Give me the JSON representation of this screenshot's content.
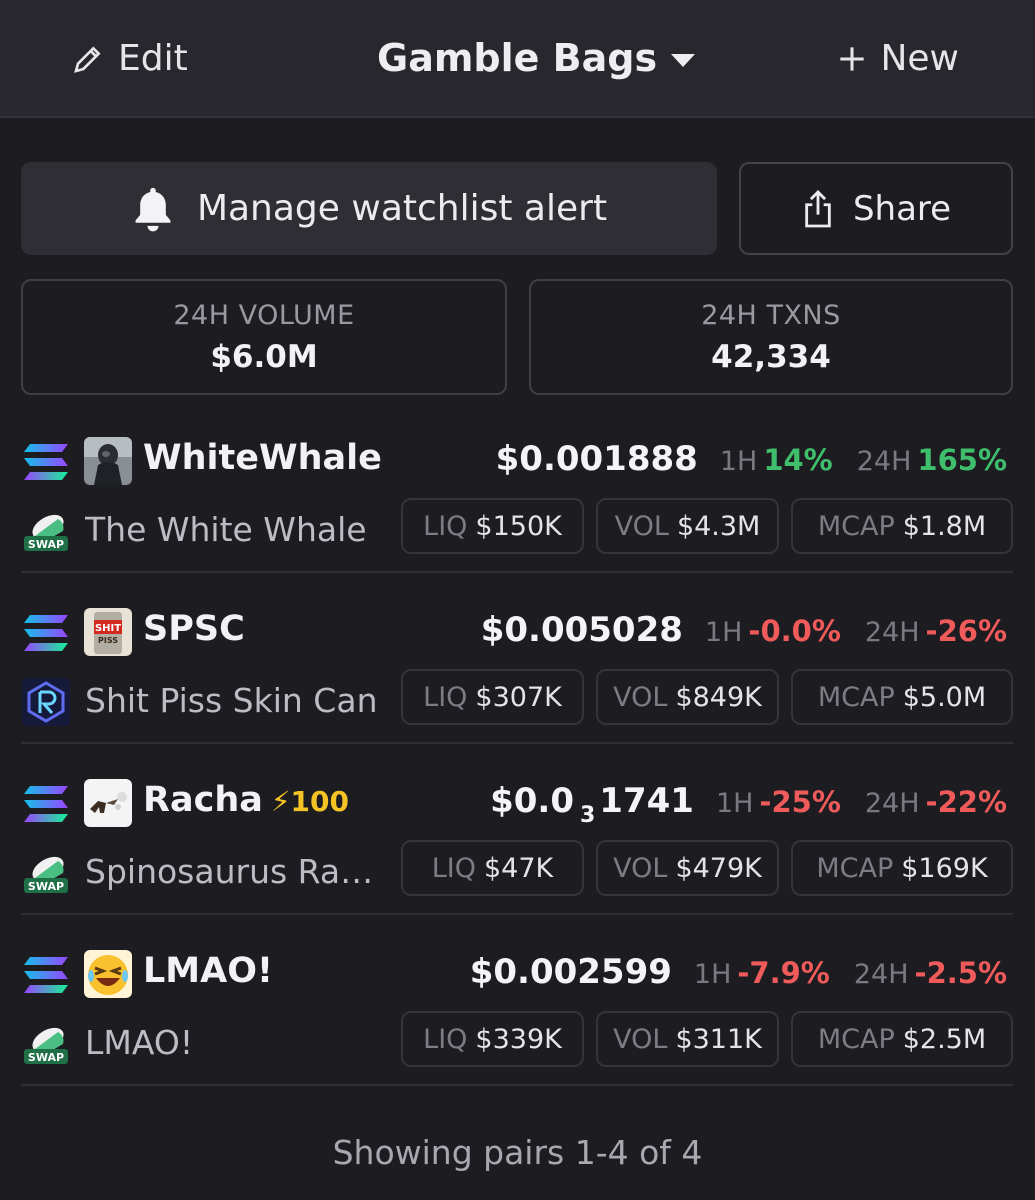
{
  "header": {
    "edit_label": "Edit",
    "title": "Gamble Bags",
    "new_label": "New"
  },
  "actions": {
    "alert_label": "Manage watchlist alert",
    "share_label": "Share"
  },
  "stats": {
    "volume_label": "24H VOLUME",
    "volume_value": "$6.0M",
    "txns_label": "24H TXNS",
    "txns_value": "42,334"
  },
  "labels": {
    "h1": "1H",
    "h24": "24H",
    "liq": "LIQ",
    "vol": "VOL",
    "mcap": "MCAP"
  },
  "pairs": [
    {
      "symbol": "WhiteWhale",
      "name": "The White Whale",
      "dex_icon": "swap-pill-icon",
      "price": "$0.001888",
      "change_1h": "14%",
      "change_24h": "165%",
      "liq": "$150K",
      "vol": "$4.3M",
      "mcap": "$1.8M"
    },
    {
      "symbol": "SPSC",
      "name": "Shit Piss Skin Can",
      "dex_icon": "raydium-icon",
      "price": "$0.005028",
      "change_1h": "-0.0%",
      "change_24h": "-26%",
      "liq": "$307K",
      "vol": "$849K",
      "mcap": "$5.0M"
    },
    {
      "symbol": "Racha",
      "boost": "100",
      "name": "Spinosaurus Rac...",
      "dex_icon": "swap-pill-icon",
      "price_prefix": "$0.0",
      "price_zeros": "3",
      "price_suffix": "1741",
      "change_1h": "-25%",
      "change_24h": "-22%",
      "liq": "$47K",
      "vol": "$479K",
      "mcap": "$169K"
    },
    {
      "symbol": "LMAO!",
      "name": "LMAO!",
      "dex_icon": "swap-pill-icon",
      "price": "$0.002599",
      "change_1h": "-7.9%",
      "change_24h": "-2.5%",
      "liq": "$339K",
      "vol": "$311K",
      "mcap": "$2.5M"
    }
  ],
  "footer": "Showing pairs 1-4 of 4",
  "colors": {
    "positive": "#3fbf6b",
    "negative": "#ef5a5a",
    "boost": "#f6c324"
  }
}
